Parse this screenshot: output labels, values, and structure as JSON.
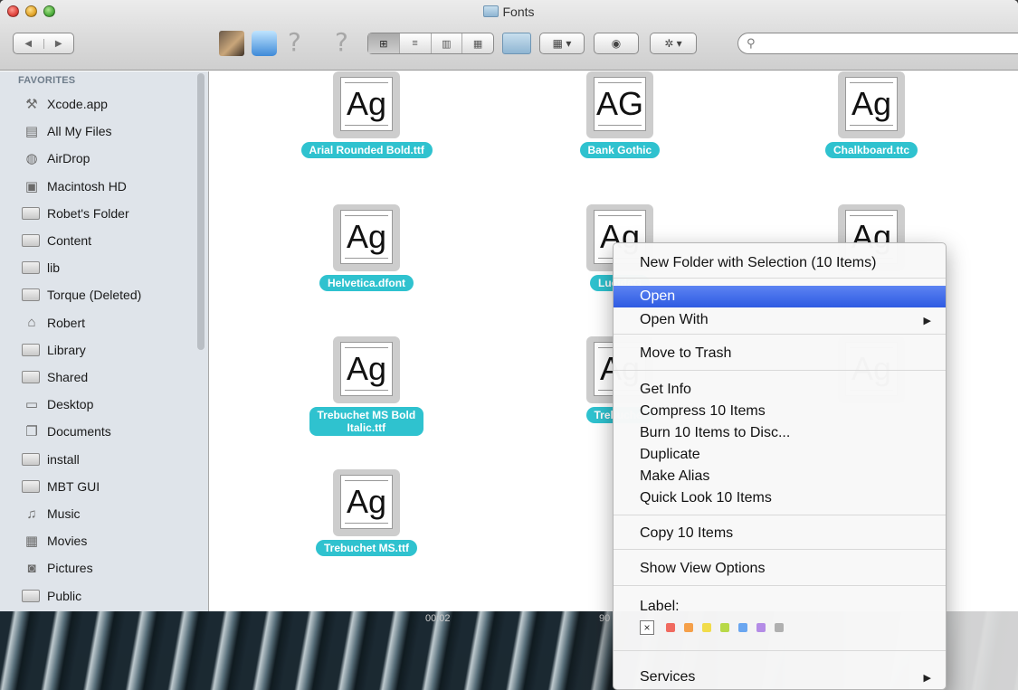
{
  "window": {
    "title": "Fonts"
  },
  "toolbar": {
    "nav_back": "◀",
    "nav_forward": "▶",
    "q_icon": "?",
    "view_modes": [
      "⊞",
      "≡",
      "▥",
      "▦"
    ],
    "arrange_label": "▦ ▾",
    "quicklook_label": "◉",
    "action_label": "✲ ▾",
    "search_placeholder": ""
  },
  "sidebar": {
    "header": "FAVORITES",
    "items": [
      {
        "label": "Xcode.app",
        "icon": "xcode-icon",
        "glyph": "⚒"
      },
      {
        "label": "All My Files",
        "icon": "all-files-icon",
        "glyph": "▤"
      },
      {
        "label": "AirDrop",
        "icon": "airdrop-icon",
        "glyph": "◍"
      },
      {
        "label": "Macintosh HD",
        "icon": "hard-drive-icon",
        "glyph": "▣"
      },
      {
        "label": "Robet's Folder",
        "icon": "folder-icon",
        "glyph": ""
      },
      {
        "label": "Content",
        "icon": "folder-icon",
        "glyph": ""
      },
      {
        "label": "lib",
        "icon": "folder-icon",
        "glyph": ""
      },
      {
        "label": "Torque (Deleted)",
        "icon": "folder-icon",
        "glyph": ""
      },
      {
        "label": "Robert",
        "icon": "home-icon",
        "glyph": "⌂"
      },
      {
        "label": "Library",
        "icon": "folder-icon",
        "glyph": ""
      },
      {
        "label": "Shared",
        "icon": "folder-icon",
        "glyph": ""
      },
      {
        "label": "Desktop",
        "icon": "desktop-icon",
        "glyph": "▭"
      },
      {
        "label": "Documents",
        "icon": "documents-icon",
        "glyph": "❐"
      },
      {
        "label": "install",
        "icon": "folder-icon",
        "glyph": ""
      },
      {
        "label": "MBT GUI",
        "icon": "folder-icon",
        "glyph": ""
      },
      {
        "label": "Music",
        "icon": "music-icon",
        "glyph": "♫"
      },
      {
        "label": "Movies",
        "icon": "movies-icon",
        "glyph": "▦"
      },
      {
        "label": "Pictures",
        "icon": "pictures-icon",
        "glyph": "◙"
      },
      {
        "label": "Public",
        "icon": "folder-icon",
        "glyph": ""
      }
    ]
  },
  "files": [
    {
      "name": "Arial Rounded Bold.ttf",
      "sample": "Ag"
    },
    {
      "name": "Bank Gothic",
      "sample": "AG"
    },
    {
      "name": "Chalkboard.ttc",
      "sample": "Ag"
    },
    {
      "name": "Helvetica.dfont",
      "sample": "Ag"
    },
    {
      "name": "LucidaG",
      "sample": "Ag"
    },
    {
      "name": "",
      "sample": "Ag"
    },
    {
      "name_line1": "Trebuchet MS Bold",
      "name_line2": "Italic.ttf",
      "sample": "Ag"
    },
    {
      "name": "Trebuchet",
      "sample": "Ag"
    },
    {
      "name": "",
      "sample": "Ag"
    },
    {
      "name": "Trebuchet MS.ttf",
      "sample": "Ag"
    }
  ],
  "context_menu": {
    "items": [
      "New Folder with Selection (10 Items)",
      "Open",
      "Open With",
      "Move to Trash",
      "Get Info",
      "Compress 10 Items",
      "Burn 10 Items to Disc...",
      "Duplicate",
      "Make Alias",
      "Quick Look 10 Items",
      "Copy 10 Items",
      "Show View Options",
      "Label:",
      "Services"
    ],
    "submenu_arrow": "▶",
    "label_clear": "×",
    "label_colors": [
      "#f06a60",
      "#f5a04a",
      "#f1dc4a",
      "#b8d948",
      "#6aa6f0",
      "#b48ce6",
      "#b0b0b0"
    ]
  },
  "desktop": {
    "time_a": "00:02",
    "time_b": "90"
  }
}
